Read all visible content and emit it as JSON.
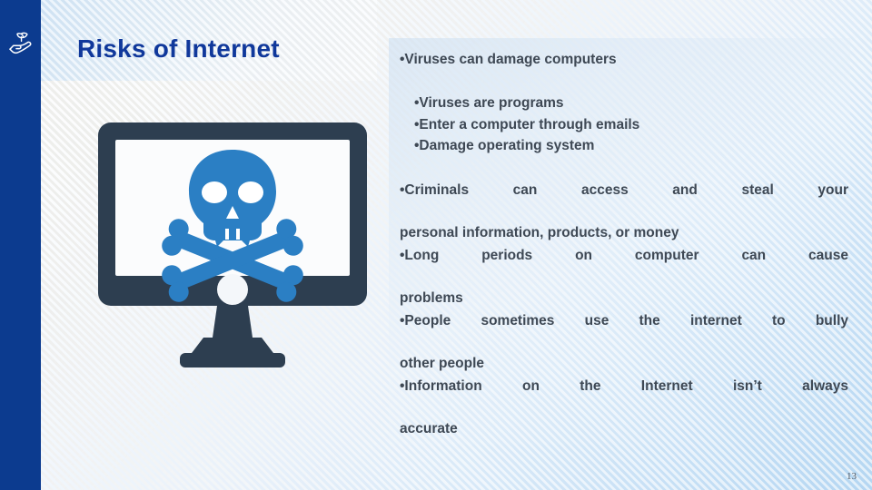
{
  "slide": {
    "title": "Risks of Internet",
    "page_number": "13",
    "brand_icon": "hand-holding-plant-icon",
    "accent_bar_color": "#0c3b8f",
    "title_color": "#10389b",
    "body_text_color": "#3e4854"
  },
  "illustration": {
    "name": "monitor-with-skull-and-crossbones",
    "monitor_color": "#2d3e50",
    "skull_color": "#2b7fc4",
    "screen_color": "#ffffff"
  },
  "bullets": {
    "lead": "•Viruses can damage computers",
    "sub_items": [
      "•Viruses are programs",
      "•Enter a computer through emails",
      "•Damage operating system"
    ],
    "criminals": "•Criminals can access and steal your personal information, products, or money",
    "criminals_line1": "•Criminals can access and steal your",
    "criminals_line2": "personal information, products, or money",
    "long_periods": "•Long periods on computer can cause problems",
    "long_periods_line1": "•Long periods on computer can cause",
    "long_periods_line2": "problems",
    "bully": "•People sometimes use the internet to bully other people",
    "bully_line1": "•People sometimes use the internet to bully",
    "bully_line2": "other people",
    "information": "•Information on the Internet isn’t always accurate",
    "information_line1": "•Information on the Internet isn’t always",
    "information_line2": "accurate"
  }
}
